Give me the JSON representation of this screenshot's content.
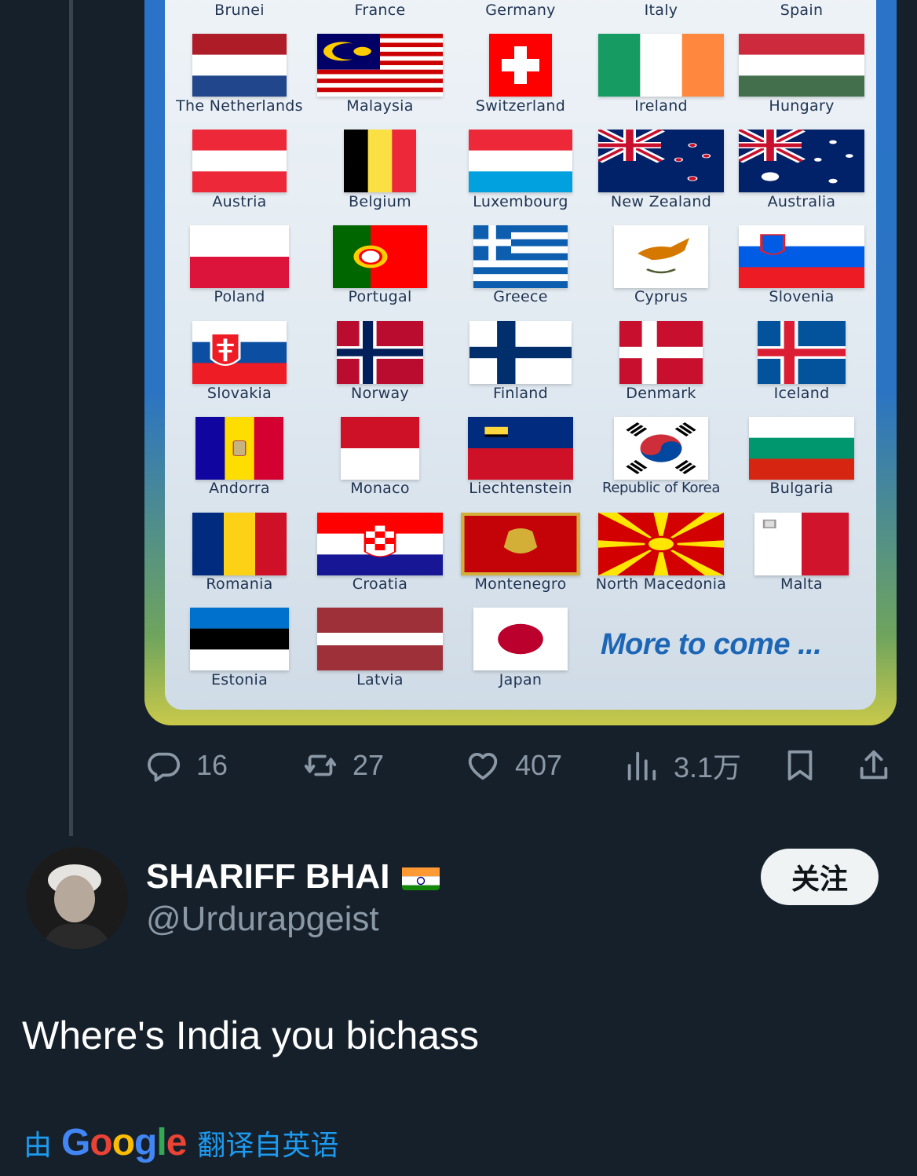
{
  "media": {
    "flags": [
      {
        "name": "Brunei"
      },
      {
        "name": "France"
      },
      {
        "name": "Germany"
      },
      {
        "name": "Italy"
      },
      {
        "name": "Spain"
      },
      {
        "name": "The Netherlands"
      },
      {
        "name": "Malaysia"
      },
      {
        "name": "Switzerland"
      },
      {
        "name": "Ireland"
      },
      {
        "name": "Hungary"
      },
      {
        "name": "Austria"
      },
      {
        "name": "Belgium"
      },
      {
        "name": "Luxembourg"
      },
      {
        "name": "New Zealand"
      },
      {
        "name": "Australia"
      },
      {
        "name": "Poland"
      },
      {
        "name": "Portugal"
      },
      {
        "name": "Greece"
      },
      {
        "name": "Cyprus"
      },
      {
        "name": "Slovenia"
      },
      {
        "name": "Slovakia"
      },
      {
        "name": "Norway"
      },
      {
        "name": "Finland"
      },
      {
        "name": "Denmark"
      },
      {
        "name": "Iceland"
      },
      {
        "name": "Andorra"
      },
      {
        "name": "Monaco"
      },
      {
        "name": "Liechtenstein"
      },
      {
        "name": "Republic of Korea"
      },
      {
        "name": "Bulgaria"
      },
      {
        "name": "Romania"
      },
      {
        "name": "Croatia"
      },
      {
        "name": "Montenegro"
      },
      {
        "name": "North Macedonia"
      },
      {
        "name": "Malta"
      },
      {
        "name": "Estonia"
      },
      {
        "name": "Latvia"
      },
      {
        "name": "Japan"
      }
    ],
    "more_text": "More to come ..."
  },
  "actions": {
    "replies": "16",
    "reposts": "27",
    "likes": "407",
    "views": "3.1万"
  },
  "author": {
    "name": "SHARIFF BHAI",
    "handle": "@Urdurapgeist",
    "follow_label": "关注"
  },
  "tweet": {
    "text": "Where's India you bichass"
  },
  "translation": {
    "by_label": "由",
    "google_letters": [
      {
        "ch": "G",
        "color": "#4285f4"
      },
      {
        "ch": "o",
        "color": "#ea4335"
      },
      {
        "ch": "o",
        "color": "#fbbc05"
      },
      {
        "ch": "g",
        "color": "#4285f4"
      },
      {
        "ch": "l",
        "color": "#34a853"
      },
      {
        "ch": "e",
        "color": "#ea4335"
      }
    ],
    "link_label": "翻译自英语"
  },
  "colors": {
    "background": "#15202b",
    "muted": "#8b98a5",
    "link": "#1d9bf0"
  }
}
